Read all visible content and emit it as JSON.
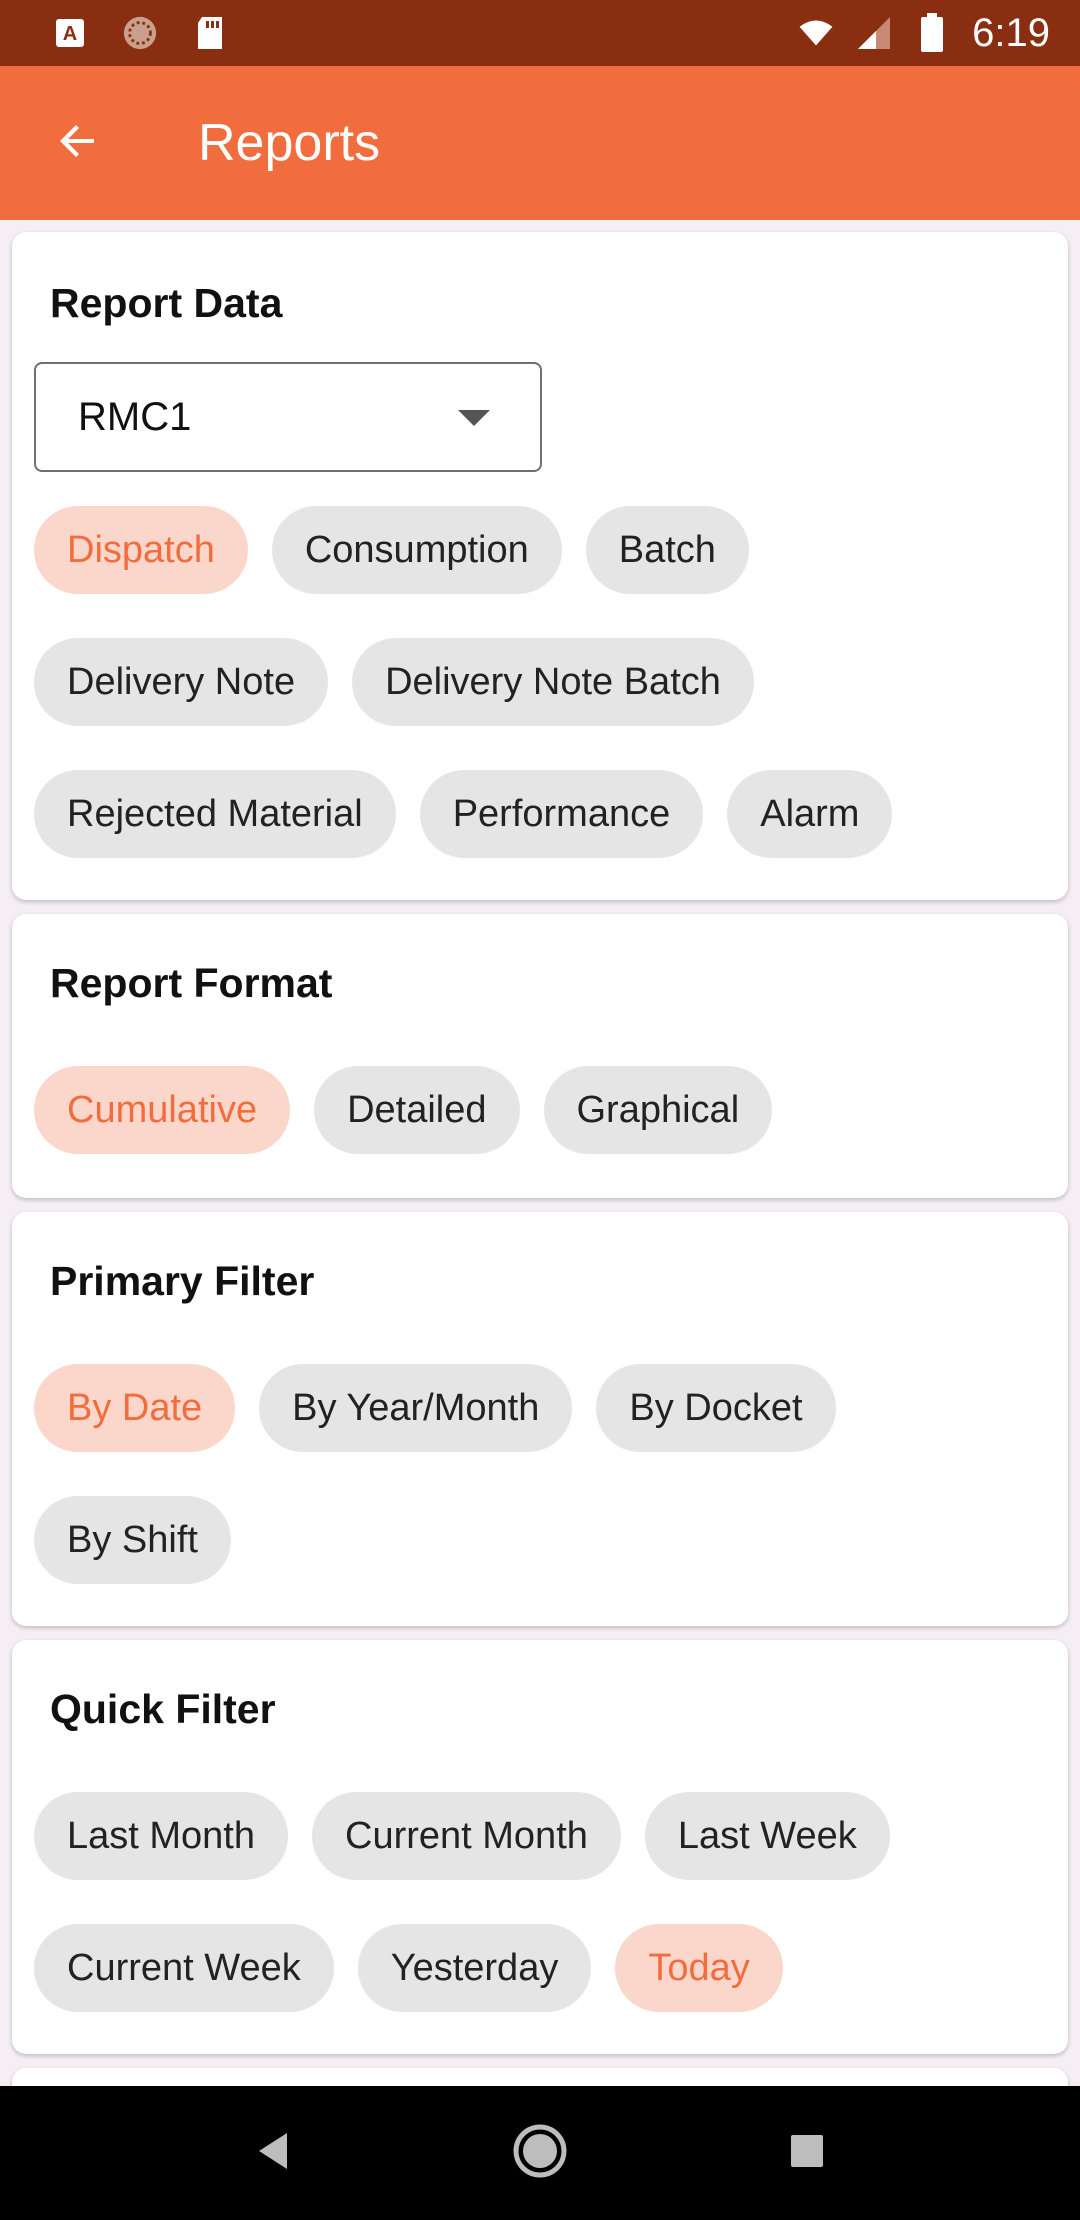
{
  "status_bar": {
    "time": "6:19",
    "left_icons": [
      "font-notification-icon",
      "sync-notification-icon",
      "sd-card-icon"
    ],
    "right_icons": [
      "wifi-icon",
      "signal-icon",
      "battery-icon"
    ]
  },
  "app_bar": {
    "title": "Reports",
    "back_icon": "arrow-back-icon"
  },
  "report_data": {
    "title": "Report Data",
    "dropdown": {
      "selected": "RMC1"
    },
    "chips": [
      {
        "label": "Dispatch",
        "selected": true
      },
      {
        "label": "Consumption",
        "selected": false
      },
      {
        "label": "Batch",
        "selected": false
      },
      {
        "label": "Delivery Note",
        "selected": false
      },
      {
        "label": "Delivery Note Batch",
        "selected": false
      },
      {
        "label": "Rejected Material",
        "selected": false
      },
      {
        "label": "Performance",
        "selected": false
      },
      {
        "label": "Alarm",
        "selected": false
      }
    ]
  },
  "report_format": {
    "title": "Report Format",
    "chips": [
      {
        "label": "Cumulative",
        "selected": true
      },
      {
        "label": "Detailed",
        "selected": false
      },
      {
        "label": "Graphical",
        "selected": false
      }
    ]
  },
  "primary_filter": {
    "title": "Primary Filter",
    "chips": [
      {
        "label": "By Date",
        "selected": true
      },
      {
        "label": "By Year/Month",
        "selected": false
      },
      {
        "label": "By Docket",
        "selected": false
      },
      {
        "label": "By Shift",
        "selected": false
      }
    ]
  },
  "quick_filter": {
    "title": "Quick Filter",
    "chips": [
      {
        "label": "Last Month",
        "selected": false
      },
      {
        "label": "Current Month",
        "selected": false
      },
      {
        "label": "Last Week",
        "selected": false
      },
      {
        "label": "Current Week",
        "selected": false
      },
      {
        "label": "Yesterday",
        "selected": false
      },
      {
        "label": "Today",
        "selected": true
      }
    ]
  },
  "nav_bar": {
    "icons": [
      "nav-back-icon",
      "nav-home-icon",
      "nav-recents-icon"
    ]
  },
  "colors": {
    "status_bar": "#8a2e12",
    "app_bar": "#f26d3d",
    "chip_selected_bg": "#fbd6ca",
    "chip_selected_text": "#f26d3d",
    "chip_bg": "#e5e5e5"
  }
}
